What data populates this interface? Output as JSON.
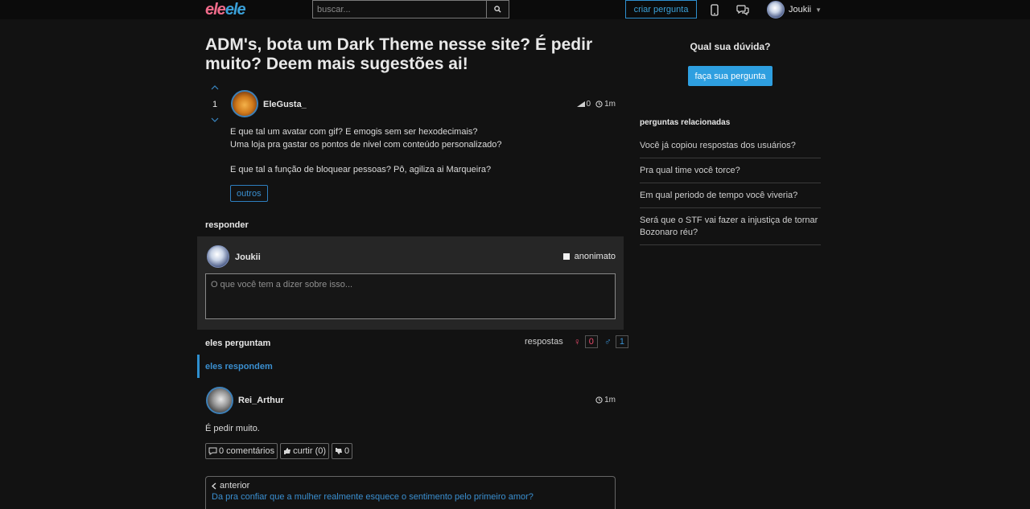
{
  "nav": {
    "logo_part1": "ele",
    "logo_part2": "ele",
    "search_placeholder": "buscar...",
    "create_label": "criar pergunta",
    "user_name": "Joukii"
  },
  "question": {
    "title": "ADM's, bota um Dark Theme nesse site? É pedir muito? Deem mais sugestões ai!",
    "votes": "1",
    "author": "EleGusta_",
    "views": "0",
    "time": "1m",
    "lines": [
      "E que tal um avatar com gif? E emogis sem ser hexodecimais?",
      "Uma loja pra gastar os pontos de nivel com conteúdo personalizado?",
      "E que tal a função de bloquear pessoas? Pô, agiliza ai Marqueira?"
    ],
    "tag": "outros"
  },
  "reply": {
    "section_label": "responder",
    "user": "Joukii",
    "anon_label": "anonimato",
    "placeholder": "O que você tem a dizer sobre isso..."
  },
  "answers": {
    "asks_label": "eles perguntam",
    "responses_label": "respostas",
    "female_count": "0",
    "male_count": "1",
    "tab_label": "eles respondem",
    "items": [
      {
        "author": "Rei_Arthur",
        "time": "1m",
        "body": "É pedir muito.",
        "comments": "0 comentários",
        "like": "curtir (0)",
        "dislike": "0"
      }
    ]
  },
  "prev": {
    "label": "anterior",
    "link": "Da pra confiar que a mulher realmente esquece o sentimento pelo primeiro amor?"
  },
  "sidebar": {
    "title": "Qual sua dúvida?",
    "ask_button": "faça sua pergunta",
    "related_title": "perguntas relacionadas",
    "related": [
      "Você já copiou respostas dos usuários?",
      "Pra qual time você torce?",
      "Em qual periodo de tempo você viveria?",
      "Será que o STF vai fazer a injustiça de tornar Bozonaro réu?"
    ]
  }
}
